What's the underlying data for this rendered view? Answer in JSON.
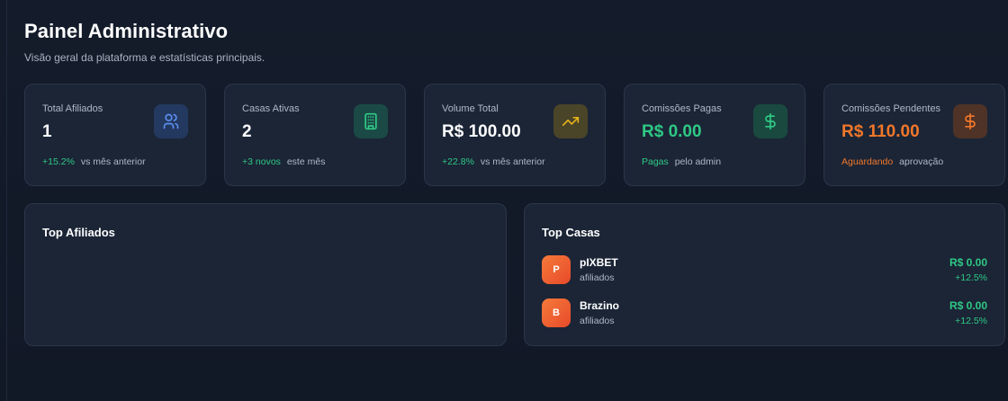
{
  "header": {
    "title": "Painel Administrativo",
    "subtitle": "Visão geral da plataforma e estatísticas principais."
  },
  "stats": [
    {
      "label": "Total Afiliados",
      "value": "1",
      "highlight": "+15.2%",
      "foot": "vs mês anterior",
      "icon": "users-icon",
      "color": "#5b8ef0"
    },
    {
      "label": "Casas Ativas",
      "value": "2",
      "highlight": "+3 novos",
      "foot": "este mês",
      "icon": "building-icon",
      "color": "#2fc985"
    },
    {
      "label": "Volume Total",
      "value": "R$ 100.00",
      "highlight": "+22.8%",
      "foot": "vs mês anterior",
      "icon": "trending-up-icon",
      "color": "#e5b21b"
    },
    {
      "label": "Comissões Pagas",
      "value": "R$ 0.00",
      "highlight": "Pagas",
      "foot": "pelo admin",
      "icon": "dollar-icon",
      "color": "#2fc985"
    },
    {
      "label": "Comissões Pendentes",
      "value": "R$ 110.00",
      "highlight": "Aguardando",
      "foot": "aprovação",
      "icon": "dollar-icon",
      "color": "#f2772a"
    }
  ],
  "top_afiliados": {
    "title": "Top Afiliados"
  },
  "top_casas": {
    "title": "Top Casas",
    "items": [
      {
        "initial": "P",
        "name": "pIXBET",
        "sub": "afiliados",
        "amount": "R$ 0.00",
        "change": "+12.5%"
      },
      {
        "initial": "B",
        "name": "Brazino",
        "sub": "afiliados",
        "amount": "R$ 0.00",
        "change": "+12.5%"
      }
    ]
  }
}
